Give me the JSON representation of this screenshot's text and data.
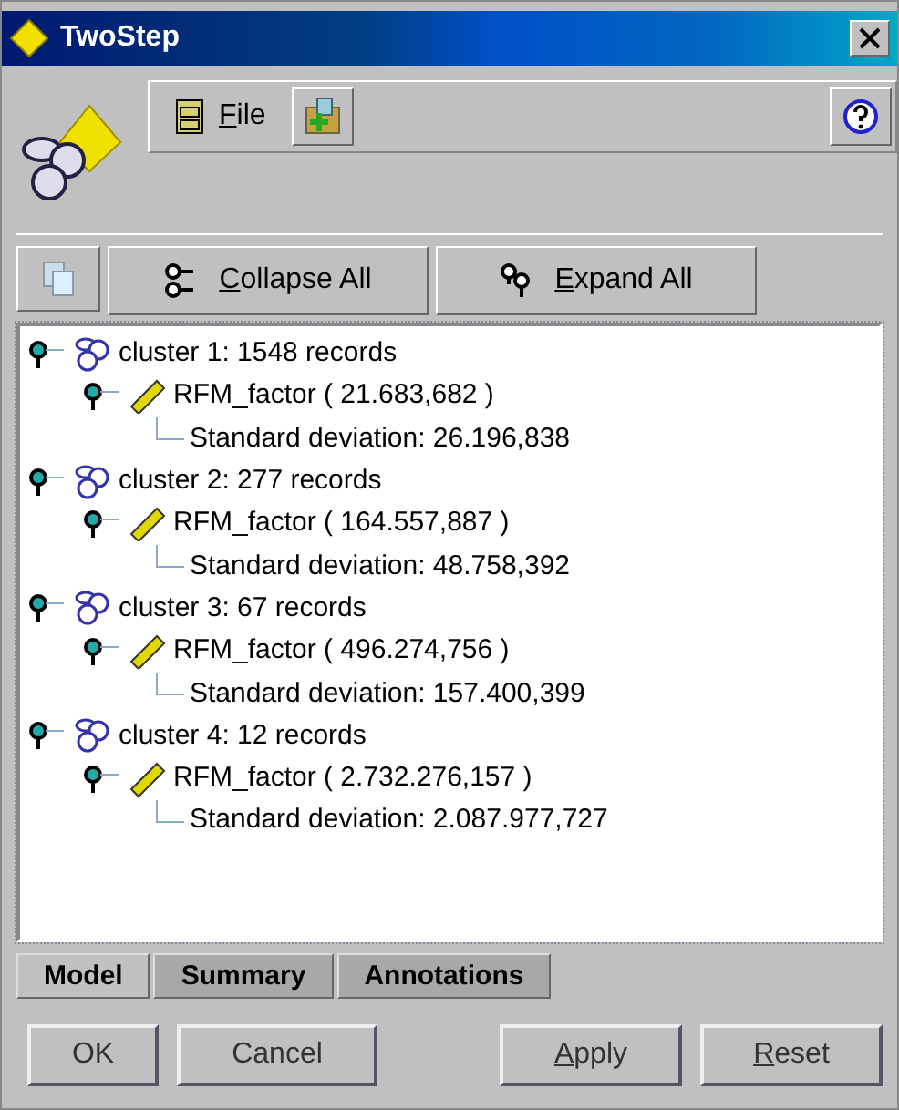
{
  "window": {
    "title": "TwoStep"
  },
  "toolbar": {
    "menu": [
      {
        "label": "File",
        "underline_first": true
      }
    ]
  },
  "tree_buttons": [
    {
      "kind": "collapse",
      "label": "Collapse All",
      "underline_first": true
    },
    {
      "kind": "expand",
      "label": "Expand All",
      "underline_first": true
    }
  ],
  "tree": [
    {
      "kind": "cluster",
      "label": "cluster 1: 1548 records",
      "children": [
        {
          "kind": "field",
          "label": "RFM_factor ( 21.683,682 )",
          "children": [
            {
              "kind": "stat",
              "label": "Standard deviation: 26.196,838"
            }
          ]
        }
      ]
    },
    {
      "kind": "cluster",
      "label": "cluster 2: 277 records",
      "children": [
        {
          "kind": "field",
          "label": "RFM_factor ( 164.557,887 )",
          "children": [
            {
              "kind": "stat",
              "label": "Standard deviation: 48.758,392"
            }
          ]
        }
      ]
    },
    {
      "kind": "cluster",
      "label": "cluster 3: 67 records",
      "children": [
        {
          "kind": "field",
          "label": "RFM_factor ( 496.274,756 )",
          "children": [
            {
              "kind": "stat",
              "label": "Standard deviation: 157.400,399"
            }
          ]
        }
      ]
    },
    {
      "kind": "cluster",
      "label": "cluster 4: 12 records",
      "children": [
        {
          "kind": "field",
          "label": "RFM_factor ( 2.732.276,157 )",
          "children": [
            {
              "kind": "stat",
              "label": "Standard deviation: 2.087.977,727"
            }
          ]
        }
      ]
    }
  ],
  "tabs": [
    {
      "label": "Model",
      "selected": true
    },
    {
      "label": "Summary",
      "selected": false
    },
    {
      "label": "Annotations",
      "selected": false
    }
  ],
  "left_buttons": [
    {
      "label": "OK",
      "underline_first": false
    },
    {
      "label": "Cancel",
      "underline_first": false
    }
  ],
  "right_buttons": [
    {
      "label": "Apply",
      "underline_first": true
    },
    {
      "label": "Reset",
      "underline_first": true
    }
  ]
}
